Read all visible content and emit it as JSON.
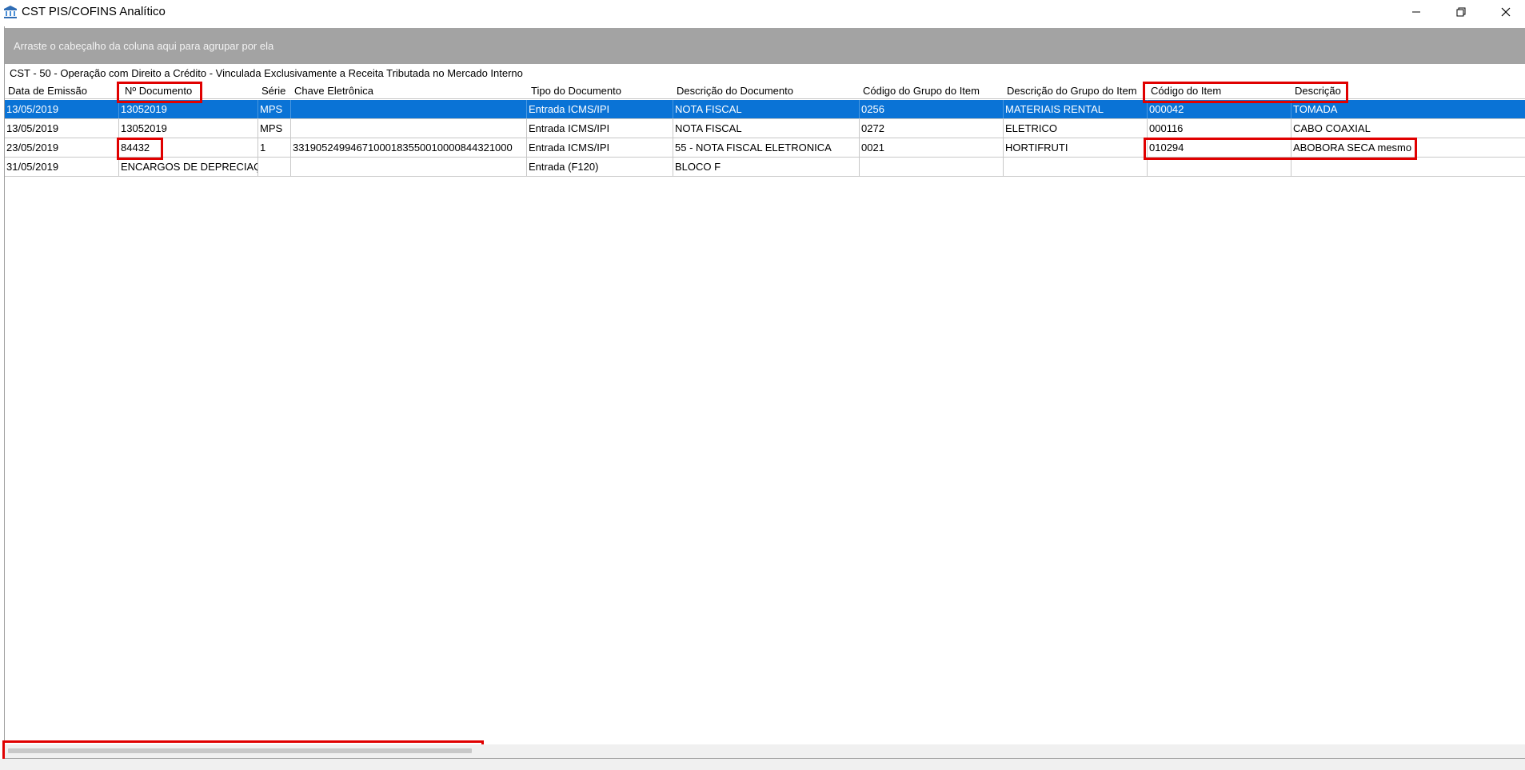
{
  "window": {
    "title": "CST PIS/COFINS Analítico",
    "icon": "bank-building-icon"
  },
  "group_panel": {
    "text": "Arraste o cabeçalho da coluna aqui para agrupar por ela"
  },
  "grid": {
    "group_label": "CST - 50 - Operação com Direito a Crédito - Vinculada Exclusivamente a Receita Tributada no Mercado Interno",
    "columns": [
      "Data de Emissão",
      "Nº Documento",
      "Série",
      "Chave Eletrônica",
      "Tipo do Documento",
      "Descrição do Documento",
      "Código do Grupo do Item",
      "Descrição do Grupo do Item",
      "Código do Item",
      "Descrição"
    ],
    "rows": [
      [
        "13/05/2019",
        "13052019",
        "MPS",
        "",
        "Entrada ICMS/IPI",
        "NOTA FISCAL",
        "0256",
        "MATERIAIS RENTAL",
        "000042",
        "TOMADA"
      ],
      [
        "13/05/2019",
        "13052019",
        "MPS",
        "",
        "Entrada ICMS/IPI",
        "NOTA FISCAL",
        "0272",
        "ELETRICO",
        "000116",
        "CABO COAXIAL"
      ],
      [
        "23/05/2019",
        "84432",
        "1",
        "33190524994671000183550010000844321000",
        "Entrada ICMS/IPI",
        "55 - NOTA FISCAL ELETRONICA",
        "0021",
        "HORTIFRUTI",
        "010294",
        "ABOBORA SECA mesmo"
      ],
      [
        "31/05/2019",
        "ENCARGOS DE DEPRECIAÇÃO",
        "",
        "",
        "Entrada (F120)",
        "BLOCO F",
        "",
        "",
        "",
        ""
      ]
    ],
    "selected_row": 0
  },
  "colors": {
    "selection": "#0a73d6",
    "group_panel_bg": "#a3a3a3",
    "highlight": "#e00000"
  }
}
